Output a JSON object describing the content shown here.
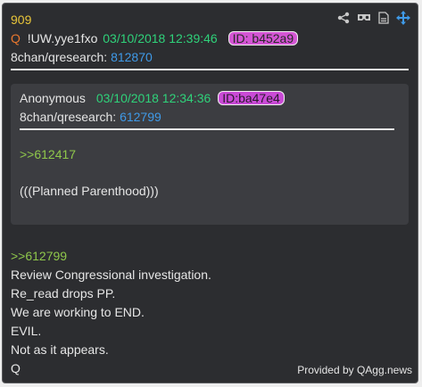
{
  "post": {
    "number": "909",
    "author_marker": "Q",
    "tripcode": "!UW.yye1fxo",
    "timestamp": "03/10/2018 12:39:46",
    "id_label": "ID: b452a9",
    "board": "8chan/qresearch:",
    "post_id": "812870"
  },
  "icons": [
    "share-icon",
    "vr-glasses-icon",
    "document-icon",
    "move-arrows-icon"
  ],
  "quoted": {
    "author": "Anonymous",
    "timestamp": "03/10/2018 12:34:36",
    "id_label": "ID:ba47e4",
    "board": "8chan/qresearch:",
    "post_id": "612799",
    "reply_ref": ">>612417",
    "text": "(((Planned Parenthood)))"
  },
  "reply_ref": ">>612799",
  "body_lines": [
    "Review Congressional investigation.",
    "Re_read drops PP.",
    "We are working to END.",
    "EVIL.",
    "Not as it appears.",
    "Q"
  ],
  "footer": "Provided by QAgg.news",
  "colors": {
    "card_bg": "#2c2d30",
    "quote_bg": "#3c3d41",
    "post_number": "#e8c53a",
    "q_marker": "#e8772e",
    "timestamp": "#2fd27a",
    "link": "#3f9ae8",
    "greentext": "#8fc74b",
    "id_badge": "#d455d4"
  }
}
